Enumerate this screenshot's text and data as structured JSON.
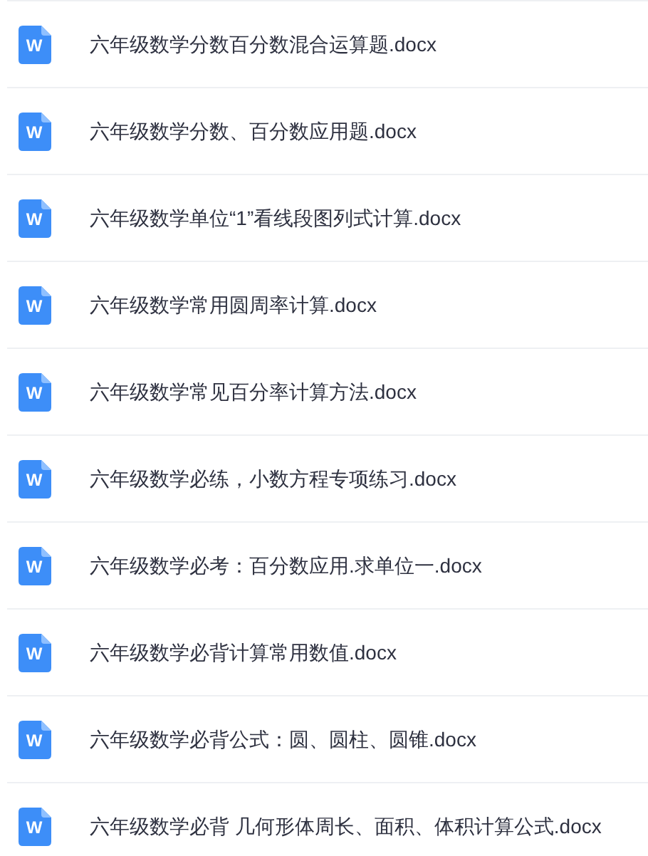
{
  "files": [
    {
      "icon_text": "W",
      "name": "六年级数学分数百分数混合运算题.docx"
    },
    {
      "icon_text": "W",
      "name": "六年级数学分数、百分数应用题.docx"
    },
    {
      "icon_text": "W",
      "name": "六年级数学单位“1”看线段图列式计算.docx"
    },
    {
      "icon_text": "W",
      "name": "六年级数学常用圆周率计算.docx"
    },
    {
      "icon_text": "W",
      "name": "六年级数学常见百分率计算方法.docx"
    },
    {
      "icon_text": "W",
      "name": "六年级数学必练，小数方程专项练习.docx"
    },
    {
      "icon_text": "W",
      "name": "六年级数学必考：百分数应用.求单位一.docx"
    },
    {
      "icon_text": "W",
      "name": "六年级数学必背计算常用数值.docx"
    },
    {
      "icon_text": "W",
      "name": "六年级数学必背公式：圆、圆柱、圆锥.docx"
    },
    {
      "icon_text": "W",
      "name": "六年级数学必背 几何形体周长、面积、体积计算公式.docx"
    }
  ]
}
